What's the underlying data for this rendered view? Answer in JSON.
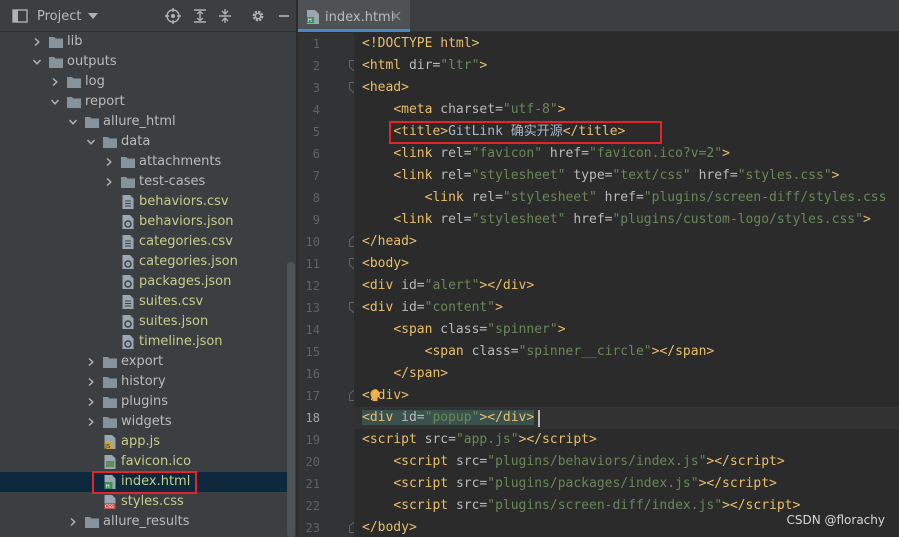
{
  "project": {
    "title": "Project",
    "tree": [
      {
        "label": "lib",
        "type": "folder",
        "depth": 1,
        "expanded": false
      },
      {
        "label": "outputs",
        "type": "folder",
        "depth": 1,
        "expanded": true
      },
      {
        "label": "log",
        "type": "folder",
        "depth": 2,
        "expanded": false
      },
      {
        "label": "report",
        "type": "folder",
        "depth": 2,
        "expanded": true
      },
      {
        "label": "allure_html",
        "type": "folder",
        "depth": 3,
        "expanded": true
      },
      {
        "label": "data",
        "type": "folder",
        "depth": 4,
        "expanded": true
      },
      {
        "label": "attachments",
        "type": "folder",
        "depth": 5,
        "expanded": false
      },
      {
        "label": "test-cases",
        "type": "folder",
        "depth": 5,
        "expanded": false
      },
      {
        "label": "behaviors.csv",
        "type": "csv",
        "depth": 5
      },
      {
        "label": "behaviors.json",
        "type": "json",
        "depth": 5
      },
      {
        "label": "categories.csv",
        "type": "csv",
        "depth": 5
      },
      {
        "label": "categories.json",
        "type": "json",
        "depth": 5
      },
      {
        "label": "packages.json",
        "type": "json",
        "depth": 5
      },
      {
        "label": "suites.csv",
        "type": "csv",
        "depth": 5
      },
      {
        "label": "suites.json",
        "type": "json",
        "depth": 5
      },
      {
        "label": "timeline.json",
        "type": "json",
        "depth": 5
      },
      {
        "label": "export",
        "type": "folder",
        "depth": 4,
        "expanded": false
      },
      {
        "label": "history",
        "type": "folder",
        "depth": 4,
        "expanded": false
      },
      {
        "label": "plugins",
        "type": "folder",
        "depth": 4,
        "expanded": false
      },
      {
        "label": "widgets",
        "type": "folder",
        "depth": 4,
        "expanded": false
      },
      {
        "label": "app.js",
        "type": "js",
        "depth": 4
      },
      {
        "label": "favicon.ico",
        "type": "ico",
        "depth": 4
      },
      {
        "label": "index.html",
        "type": "html",
        "depth": 4,
        "selected": true
      },
      {
        "label": "styles.css",
        "type": "css",
        "depth": 4
      },
      {
        "label": "allure_results",
        "type": "folder",
        "depth": 3,
        "expanded": false
      }
    ]
  },
  "editor": {
    "tab_label": "index.html",
    "current_line": 18,
    "lines": [
      {
        "n": "1",
        "html": "<span class='tg'>&lt;!DOCTYPE html&gt;</span>"
      },
      {
        "n": "2",
        "html": "<span class='tg'>&lt;html </span><span class='at'>dir=</span><span class='vl'>\"ltr\"</span><span class='tg'>&gt;</span>"
      },
      {
        "n": "3",
        "html": "<span class='tg'>&lt;head&gt;</span>"
      },
      {
        "n": "4",
        "html": "    <span class='tg'>&lt;meta </span><span class='at'>charset=</span><span class='vl'>\"utf-8\"</span><span class='tg'>&gt;</span>"
      },
      {
        "n": "5",
        "html": "    <span class='tg'>&lt;title&gt;</span><span class='tx'>GitLink 确实开源</span><span class='tg'>&lt;/title&gt;</span>"
      },
      {
        "n": "6",
        "html": "    <span class='tg'>&lt;link </span><span class='at'>rel=</span><span class='vl'>\"favicon\"</span><span class='at'> href=</span><span class='vl'>\"favicon.ico?v=2\"</span><span class='tg'>&gt;</span>"
      },
      {
        "n": "7",
        "html": "    <span class='tg'>&lt;link </span><span class='at'>rel=</span><span class='vl'>\"stylesheet\"</span><span class='at'> type=</span><span class='vl'>\"text/css\"</span><span class='at'> href=</span><span class='vl'>\"styles.css\"</span><span class='tg'>&gt;</span>"
      },
      {
        "n": "8",
        "html": "        <span class='tg'>&lt;link </span><span class='at'>rel=</span><span class='vl'>\"stylesheet\"</span><span class='at'> href=</span><span class='vl'>\"plugins/screen-diff/styles.css</span>"
      },
      {
        "n": "9",
        "html": "    <span class='tg'>&lt;link </span><span class='at'>rel=</span><span class='vl'>\"stylesheet\"</span><span class='at'> href=</span><span class='vl'>\"plugins/custom-logo/styles.css\"</span><span class='tg'>&gt;</span>"
      },
      {
        "n": "10",
        "html": "<span class='tg'>&lt;/head&gt;</span>"
      },
      {
        "n": "11",
        "html": "<span class='tg'>&lt;body&gt;</span>"
      },
      {
        "n": "12",
        "html": "<span class='tg'>&lt;div </span><span class='at'>id=</span><span class='vl'>\"alert\"</span><span class='tg'>&gt;&lt;/div&gt;</span>"
      },
      {
        "n": "13",
        "html": "<span class='tg'>&lt;div </span><span class='at'>id=</span><span class='vl'>\"content\"</span><span class='tg'>&gt;</span>"
      },
      {
        "n": "14",
        "html": "    <span class='tg'>&lt;span </span><span class='at'>class=</span><span class='vl'>\"spinner\"</span><span class='tg'>&gt;</span>"
      },
      {
        "n": "15",
        "html": "        <span class='tg'>&lt;span </span><span class='at'>class=</span><span class='vl'>\"spinner__circle\"</span><span class='tg'>&gt;&lt;/span&gt;</span>"
      },
      {
        "n": "16",
        "html": "    <span class='tg'>&lt;/span&gt;</span>"
      },
      {
        "n": "17",
        "html": "<span class='tg'>&lt;/div&gt;</span>"
      },
      {
        "n": "18",
        "html": "<span class='tg tag-hl'>&lt;div </span><span class='at tag-hl'>id=</span><span class='vl tag-hl'>\"popup\"</span><span class='tg tag-hl'>&gt;</span><span class='tg tag-hl'>&lt;/div&gt;</span>"
      },
      {
        "n": "19",
        "html": "<span class='tg'>&lt;script </span><span class='at'>src=</span><span class='vl'>\"app.js\"</span><span class='tg'>&gt;&lt;/script&gt;</span>"
      },
      {
        "n": "20",
        "html": "    <span class='tg'>&lt;script </span><span class='at'>src=</span><span class='vl'>\"plugins/behaviors/index.js\"</span><span class='tg'>&gt;&lt;/script&gt;</span>"
      },
      {
        "n": "21",
        "html": "    <span class='tg'>&lt;script </span><span class='at'>src=</span><span class='vl'>\"plugins/packages/index.js\"</span><span class='tg'>&gt;&lt;/script&gt;</span>"
      },
      {
        "n": "22",
        "html": "    <span class='tg'>&lt;script </span><span class='at'>src=</span><span class='vl'>\"plugins/screen-diff/index.js\"</span><span class='tg'>&gt;&lt;/script&gt;</span>"
      },
      {
        "n": "23",
        "html": "<span class='tg'>&lt;/body&gt;</span>"
      }
    ]
  },
  "watermark": "CSDN @florachy",
  "colors": {
    "background": "#2b2b2b",
    "panel": "#3c3f41",
    "tag": "#e8bf6a",
    "attribute": "#bababa",
    "string": "#6a8759",
    "highlight_box": "#e3242b",
    "selection": "#0d293e"
  },
  "icons": [
    "project-icon",
    "dropdown-icon",
    "target-icon",
    "expand-all-icon",
    "collapse-all-icon",
    "gear-icon",
    "minimize-icon",
    "folder-icon",
    "csv-file-icon",
    "json-file-icon",
    "js-file-icon",
    "ico-file-icon",
    "html-file-icon",
    "css-file-icon",
    "close-icon",
    "bulb-icon"
  ]
}
